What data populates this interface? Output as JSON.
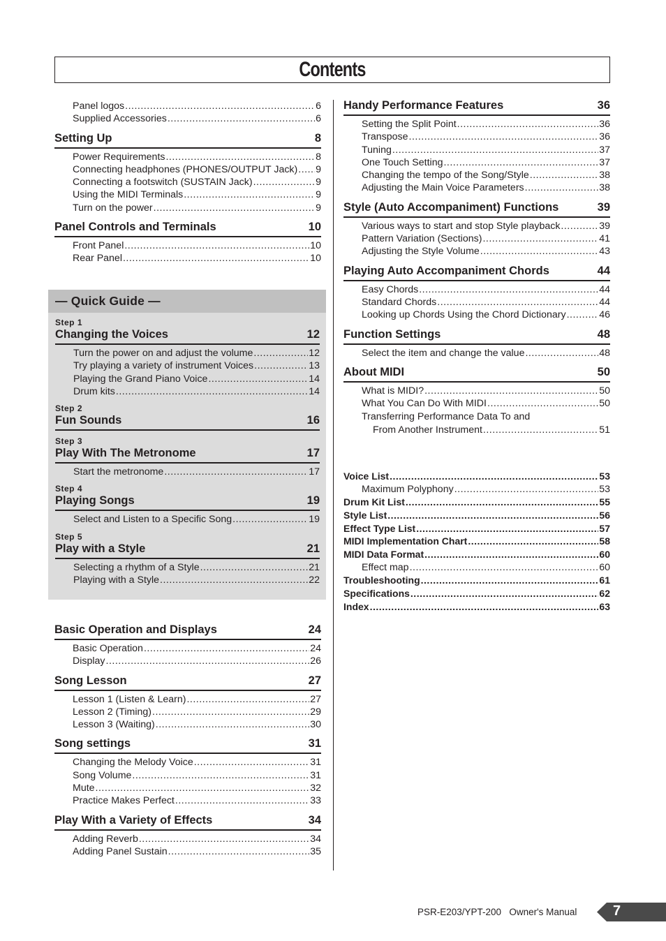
{
  "title": "Contents",
  "left_top": {
    "intro": [
      {
        "label": "Panel logos",
        "page": "6"
      },
      {
        "label": "Supplied Accessories",
        "page": "6"
      }
    ],
    "sections": [
      {
        "title": "Setting Up",
        "page": "8",
        "items": [
          {
            "label": "Power Requirements",
            "page": "8"
          },
          {
            "label": "Connecting headphones (PHONES/OUTPUT Jack)",
            "page": "9"
          },
          {
            "label": "Connecting a footswitch (SUSTAIN Jack)",
            "page": "9"
          },
          {
            "label": "Using the MIDI Terminals",
            "page": "9"
          },
          {
            "label": "Turn on the power",
            "page": "9"
          }
        ]
      },
      {
        "title": "Panel Controls and Terminals",
        "page": "10",
        "items": [
          {
            "label": "Front Panel",
            "page": "10"
          },
          {
            "label": "Rear Panel",
            "page": "10"
          }
        ]
      }
    ]
  },
  "quick_guide": {
    "heading": "— Quick Guide —",
    "steps": [
      {
        "step": "Step 1",
        "title": "Changing the Voices",
        "page": "12",
        "items": [
          {
            "label": "Turn the power on and adjust the volume",
            "page": "12"
          },
          {
            "label": "Try playing a variety of instrument Voices",
            "page": "13"
          },
          {
            "label": "Playing the Grand Piano Voice",
            "page": "14"
          },
          {
            "label": "Drum kits",
            "page": "14"
          }
        ]
      },
      {
        "step": "Step 2",
        "title": "Fun Sounds",
        "page": "16",
        "items": []
      },
      {
        "step": "Step 3",
        "title": "Play With The Metronome",
        "page": "17",
        "items": [
          {
            "label": "Start the metronome",
            "page": "17"
          }
        ]
      },
      {
        "step": "Step 4",
        "title": "Playing Songs",
        "page": "19",
        "items": [
          {
            "label": "Select and Listen to a Specific Song",
            "page": "19"
          }
        ]
      },
      {
        "step": "Step 5",
        "title": "Play with a Style",
        "page": "21",
        "items": [
          {
            "label": "Selecting a rhythm of a Style",
            "page": "21"
          },
          {
            "label": "Playing with a Style",
            "page": "22"
          }
        ]
      }
    ]
  },
  "left_bottom": {
    "sections": [
      {
        "title": "Basic Operation and Displays",
        "page": "24",
        "items": [
          {
            "label": "Basic Operation",
            "page": "24"
          },
          {
            "label": "Display",
            "page": "26"
          }
        ]
      },
      {
        "title": "Song Lesson",
        "page": "27",
        "items": [
          {
            "label": "Lesson 1 (Listen & Learn)",
            "page": "27"
          },
          {
            "label": "Lesson 2 (Timing)",
            "page": "29"
          },
          {
            "label": "Lesson 3 (Waiting)",
            "page": "30"
          }
        ]
      },
      {
        "title": "Song settings",
        "page": "31",
        "items": [
          {
            "label": "Changing the Melody Voice",
            "page": "31"
          },
          {
            "label": "Song Volume",
            "page": "31"
          },
          {
            "label": "Mute",
            "page": "32"
          },
          {
            "label": "Practice Makes Perfect",
            "page": "33"
          }
        ]
      },
      {
        "title": "Play With a Variety of Effects",
        "page": "34",
        "items": [
          {
            "label": "Adding Reverb",
            "page": "34"
          },
          {
            "label": "Adding Panel Sustain",
            "page": "35"
          }
        ]
      }
    ]
  },
  "right": {
    "sections": [
      {
        "title": "Handy Performance Features",
        "page": "36",
        "items": [
          {
            "label": "Setting the Split Point",
            "page": "36"
          },
          {
            "label": "Transpose",
            "page": "36"
          },
          {
            "label": "Tuning",
            "page": "37"
          },
          {
            "label": "One Touch Setting",
            "page": "37"
          },
          {
            "label": "Changing the tempo of the Song/Style",
            "page": "38"
          },
          {
            "label": "Adjusting the Main Voice Parameters",
            "page": "38"
          }
        ]
      },
      {
        "title": "Style (Auto Accompaniment) Functions",
        "page": "39",
        "items": [
          {
            "label": "Various ways to start and stop Style playback",
            "page": "39"
          },
          {
            "label": "Pattern Variation (Sections)",
            "page": "41"
          },
          {
            "label": "Adjusting the Style Volume",
            "page": "43"
          }
        ]
      },
      {
        "title": "Playing Auto Accompaniment Chords",
        "page": "44",
        "items": [
          {
            "label": "Easy Chords",
            "page": "44"
          },
          {
            "label": "Standard Chords",
            "page": "44"
          },
          {
            "label": "Looking up Chords Using the Chord Dictionary",
            "page": "46"
          }
        ]
      },
      {
        "title": "Function Settings",
        "page": "48",
        "items": [
          {
            "label": "Select the item and change the value",
            "page": "48"
          }
        ]
      },
      {
        "title": "About MIDI",
        "page": "50",
        "items": [
          {
            "label": "What is MIDI?",
            "page": "50"
          },
          {
            "label": "What You Can Do With MIDI",
            "page": "50"
          }
        ]
      }
    ],
    "midi_transfer": {
      "line1": "Transferring Performance Data To and",
      "line2": "From Another Instrument",
      "page": "51"
    },
    "appendix": [
      {
        "label": "Voice List",
        "page": "53",
        "bold": true
      },
      {
        "label": "Maximum Polyphony",
        "page": "53",
        "bold": false
      },
      {
        "label": "Drum Kit List",
        "page": "55",
        "bold": true
      },
      {
        "label": "Style List",
        "page": "56",
        "bold": true
      },
      {
        "label": "Effect Type List",
        "page": "57",
        "bold": true
      },
      {
        "label": "MIDI Implementation Chart",
        "page": "58",
        "bold": true
      },
      {
        "label": "MIDI Data Format",
        "page": "60",
        "bold": true
      },
      {
        "label": "Effect map",
        "page": "60",
        "bold": false
      },
      {
        "label": "Troubleshooting",
        "page": "61",
        "bold": true
      },
      {
        "label": "Specifications",
        "page": "62",
        "bold": true
      },
      {
        "label": "Index",
        "page": "63",
        "bold": true
      }
    ]
  },
  "footer": {
    "manual": "PSR-E203/YPT-200   Owner's Manual",
    "page_number": "7"
  }
}
